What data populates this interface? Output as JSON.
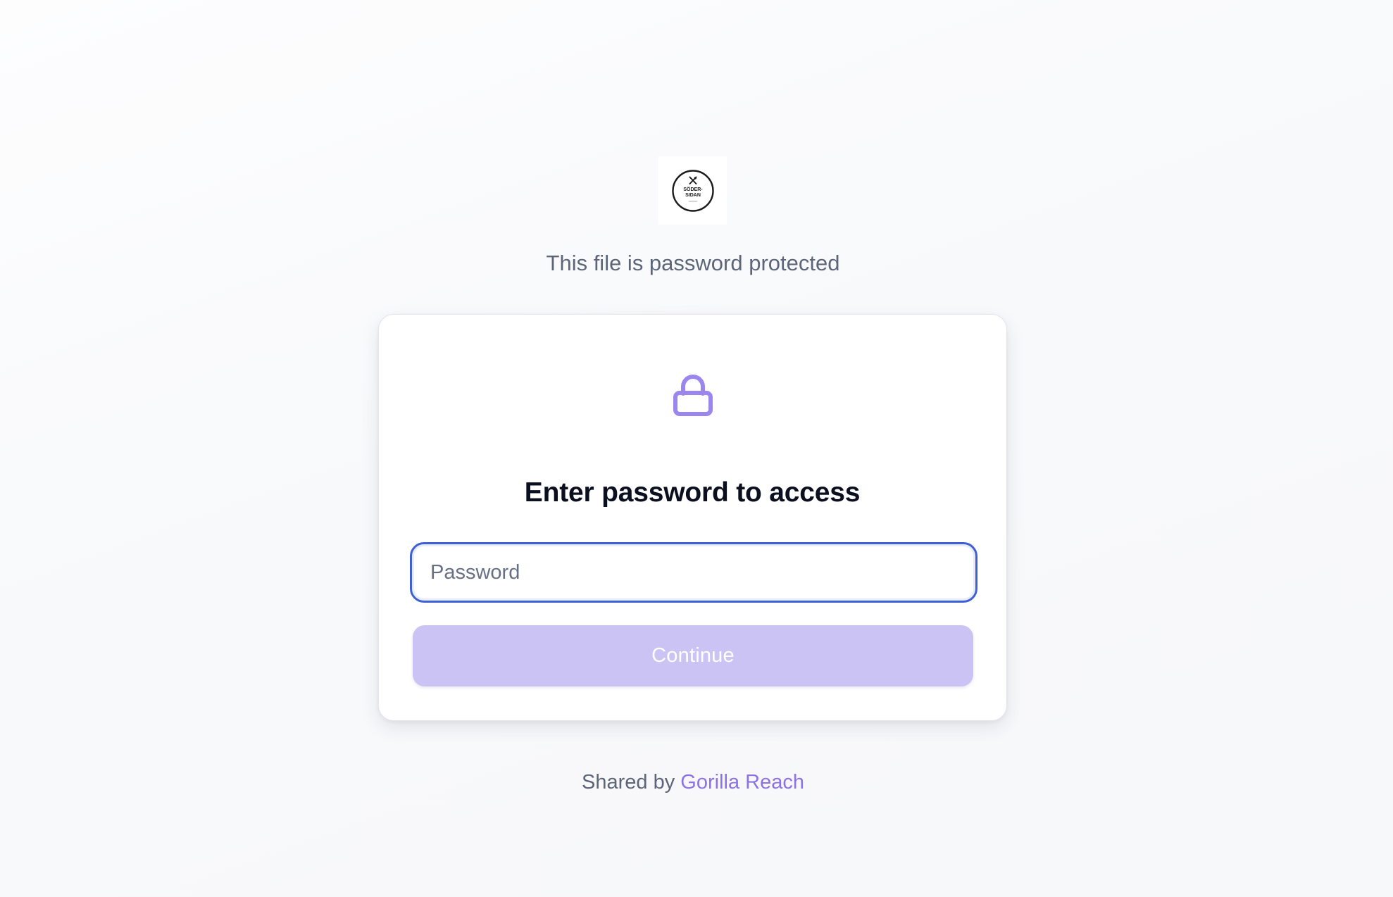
{
  "logo": {
    "icon": "crossed-fork-knife-icon",
    "text_line1": "SÖDER-",
    "text_line2": "SIDAN",
    "ring_color": "#1a1a1a"
  },
  "header": {
    "subtitle": "This file is password protected"
  },
  "card": {
    "lock_icon": "lock-icon",
    "lock_color": "#9a86ec",
    "title": "Enter password to access",
    "password": {
      "value": "",
      "placeholder": "Password",
      "type": "password",
      "focus_color": "#3f5fd4"
    },
    "continue_label": "Continue",
    "continue_color": "#ccc3f5"
  },
  "footer": {
    "shared_by_label": "Shared by",
    "owner_name": "Gorilla Reach",
    "owner_color": "#8b73e6"
  }
}
